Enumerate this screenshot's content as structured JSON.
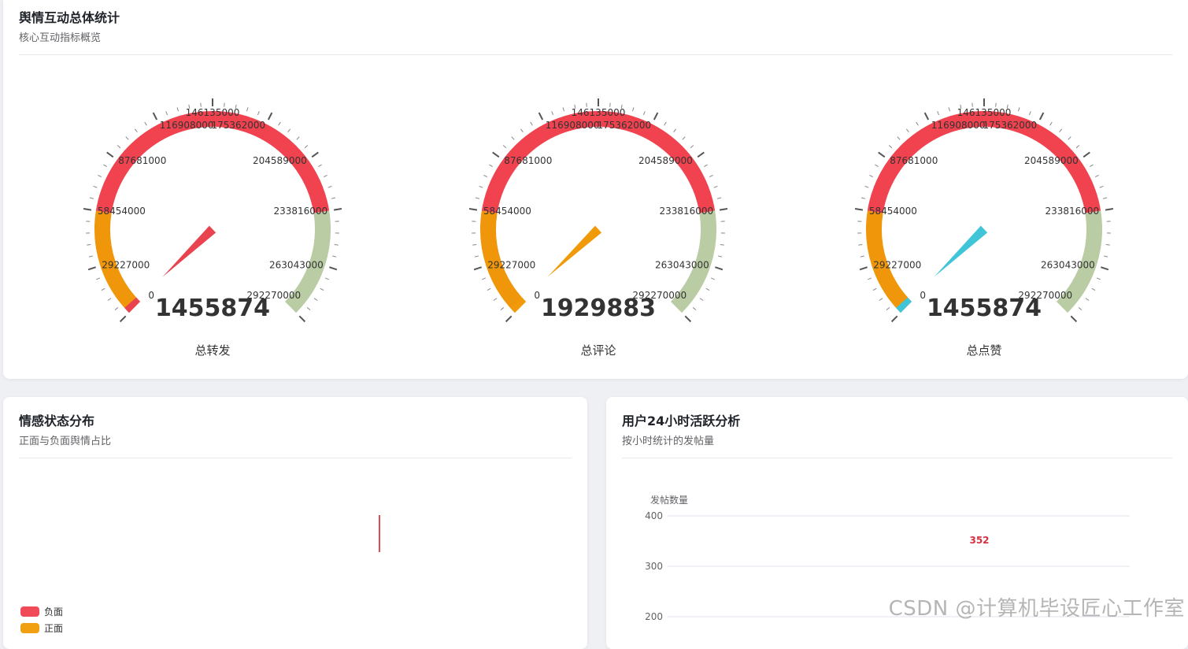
{
  "overview": {
    "title": "舆情互动总体统计",
    "subtitle": "核心互动指标概览"
  },
  "gauge_colors": {
    "low": "#f0960a",
    "mid": "#f0434f",
    "high": "#b9cca4"
  },
  "chart_data": [
    {
      "type": "gauge",
      "label": "总转发",
      "value": 1455874,
      "min": 0,
      "max": 292270000,
      "ticks": [
        "0",
        "29227000",
        "58454000",
        "87681000",
        "116908000",
        "146135000",
        "175362000",
        "204589000",
        "233816000",
        "263043000",
        "292270000"
      ],
      "pointer_color": "#e8434f",
      "low_stub_color": "#e8434f"
    },
    {
      "type": "gauge",
      "label": "总评论",
      "value": 1929883,
      "min": 0,
      "max": 292270000,
      "ticks": [
        "0",
        "29227000",
        "58454000",
        "87681000",
        "116908000",
        "146135000",
        "175362000",
        "204589000",
        "233816000",
        "263043000",
        "292270000"
      ],
      "pointer_color": "#f09a0a",
      "low_stub_color": "#f09a0a"
    },
    {
      "type": "gauge",
      "label": "总点赞",
      "value": 1455874,
      "min": 0,
      "max": 292270000,
      "ticks": [
        "0",
        "29227000",
        "58454000",
        "87681000",
        "116908000",
        "146135000",
        "175362000",
        "204589000",
        "233816000",
        "263043000",
        "292270000"
      ],
      "pointer_color": "#3fc4d8",
      "low_stub_color": "#3fc4d8"
    },
    {
      "type": "pie",
      "title": "情感状态分布",
      "subtitle": "正面与负面舆情占比",
      "legend": [
        {
          "name": "负面",
          "color": "#f04a58"
        },
        {
          "name": "正面",
          "color": "#f0a010"
        }
      ]
    },
    {
      "type": "bar",
      "title": "用户24小时活跃分析",
      "subtitle": "按小时统计的发帖量",
      "ylabel": "发帖数量",
      "yticks": [
        "400",
        "300",
        "200"
      ],
      "ylim": [
        0,
        400
      ],
      "data_labels": [
        "352"
      ],
      "label_color": "#d83040"
    }
  ],
  "watermark": "CSDN @计算机毕设匠心工作室"
}
